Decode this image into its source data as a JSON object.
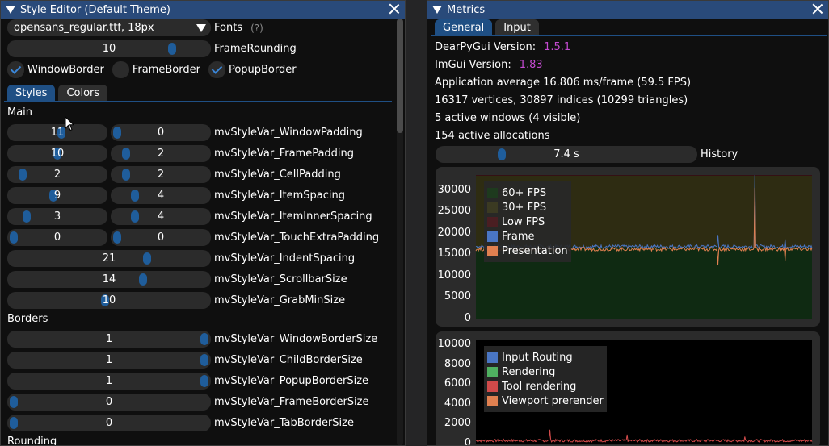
{
  "style_editor": {
    "title": "Style Editor (Default Theme)",
    "font_combo": "opensans_regular.ttf, 18px",
    "fonts_label": "Fonts",
    "fonts_help": "(?)",
    "frame_rounding": {
      "value": "10",
      "label": "FrameRounding",
      "fraction": 0.83
    },
    "checkboxes": [
      {
        "label": "WindowBorder",
        "checked": true
      },
      {
        "label": "FrameBorder",
        "checked": false
      },
      {
        "label": "PopupBorder",
        "checked": true
      }
    ],
    "tabs": [
      "Styles",
      "Colors"
    ],
    "sections": {
      "main": "Main",
      "borders": "Borders",
      "rounding": "Rounding"
    },
    "main_rows": [
      {
        "a": "11",
        "b": "0",
        "fa": 0.55,
        "fb": 0.0,
        "label": "mvStyleVar_WindowPadding"
      },
      {
        "a": "10",
        "b": "2",
        "fa": 0.5,
        "fb": 0.1,
        "label": "mvStyleVar_FramePadding"
      },
      {
        "a": "2",
        "b": "2",
        "fa": 0.1,
        "fb": 0.1,
        "label": "mvStyleVar_CellPadding"
      },
      {
        "a": "9",
        "b": "4",
        "fa": 0.45,
        "fb": 0.2,
        "label": "mvStyleVar_ItemSpacing"
      },
      {
        "a": "3",
        "b": "4",
        "fa": 0.15,
        "fb": 0.2,
        "label": "mvStyleVar_ItemInnerSpacing"
      },
      {
        "a": "0",
        "b": "0",
        "fa": 0.0,
        "fb": 0.0,
        "label": "mvStyleVar_TouchExtraPadding"
      }
    ],
    "single_rows": [
      {
        "v": "21",
        "f": 0.7,
        "label": "mvStyleVar_IndentSpacing"
      },
      {
        "v": "14",
        "f": 0.68,
        "label": "mvStyleVar_ScrollbarSize"
      },
      {
        "v": "10",
        "f": 0.48,
        "label": "mvStyleVar_GrabMinSize"
      }
    ],
    "border_rows": [
      {
        "v": "1",
        "f": 1.0,
        "label": "mvStyleVar_WindowBorderSize"
      },
      {
        "v": "1",
        "f": 1.0,
        "label": "mvStyleVar_ChildBorderSize"
      },
      {
        "v": "1",
        "f": 1.0,
        "label": "mvStyleVar_PopupBorderSize"
      },
      {
        "v": "0",
        "f": 0.0,
        "label": "mvStyleVar_FrameBorderSize"
      },
      {
        "v": "0",
        "f": 0.0,
        "label": "mvStyleVar_TabBorderSize"
      }
    ]
  },
  "metrics": {
    "title": "Metrics",
    "tabs": [
      "General",
      "Input"
    ],
    "dpg_label": "DearPyGui Version:",
    "dpg_version": "1.5.1",
    "imgui_label": "ImGui Version:",
    "imgui_version": "1.83",
    "app_average": "Application average 16.806 ms/frame (59.5 FPS)",
    "vertices": "16317 vertices, 30897 indices (10299 triangles)",
    "windows": "5 active windows (4 visible)",
    "allocations": "154 active allocations",
    "history": {
      "value": "7.4 s",
      "label": "History",
      "fraction": 0.24
    }
  },
  "chart_data": [
    {
      "type": "line",
      "yticks": [
        "30000",
        "25000",
        "20000",
        "15000",
        "10000",
        "5000",
        "0"
      ],
      "ylim": [
        0,
        33500
      ],
      "legend": [
        {
          "name": "60+ FPS",
          "color": "#1e3a1e"
        },
        {
          "name": "30+ FPS",
          "color": "#3b3a22"
        },
        {
          "name": "Low FPS",
          "color": "#4a1e22"
        },
        {
          "name": "Frame",
          "color": "#4a76c4"
        },
        {
          "name": "Presentation",
          "color": "#e08050"
        }
      ],
      "bands": [
        {
          "from": 0,
          "to": 16667,
          "color": "#0f2a12"
        },
        {
          "from": 16667,
          "to": 33333,
          "color": "#2e2c12"
        },
        {
          "from": 33333,
          "to": 33500,
          "color": "#3a1216"
        }
      ],
      "series": [
        {
          "name": "Frame",
          "baseline": 16800,
          "spikes": [
            [
              0.72,
              19500
            ],
            [
              0.83,
              33500
            ],
            [
              0.92,
              18500
            ]
          ]
        },
        {
          "name": "Presentation",
          "baseline": 16200,
          "spikes": [
            [
              0.72,
              12500
            ],
            [
              0.83,
              30500
            ],
            [
              0.92,
              13500
            ]
          ]
        }
      ]
    },
    {
      "type": "line",
      "yticks": [
        "10000",
        "8000",
        "6000",
        "4000",
        "2000",
        "0"
      ],
      "ylim": [
        0,
        10500
      ],
      "legend": [
        {
          "name": "Input Routing",
          "color": "#4a76c4"
        },
        {
          "name": "Rendering",
          "color": "#4fb060"
        },
        {
          "name": "Tool rendering",
          "color": "#d04a4a"
        },
        {
          "name": "Viewport prerender",
          "color": "#e08050"
        }
      ],
      "series": [
        {
          "name": "Tool rendering",
          "baseline": 300,
          "spikes": [
            [
              0.22,
              1400
            ],
            [
              0.45,
              900
            ],
            [
              0.8,
              700
            ]
          ]
        }
      ]
    }
  ],
  "colors": {
    "title_bar": "#294a7a",
    "accent": "#1f5d9b",
    "version": "#c44bd1"
  }
}
